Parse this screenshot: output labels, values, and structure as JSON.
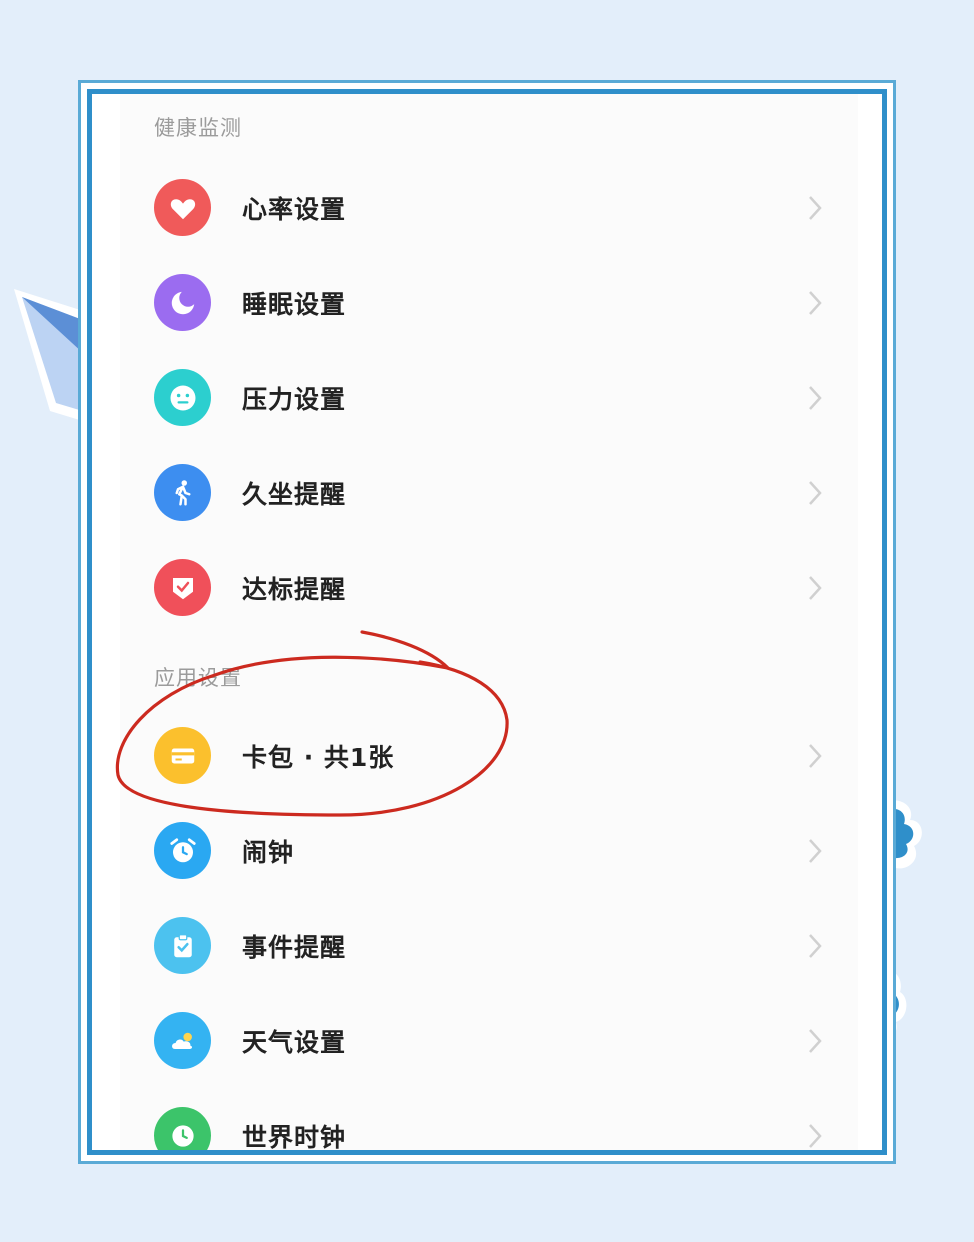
{
  "sections": [
    {
      "title": "健康监测",
      "items": [
        {
          "label": "心率设置",
          "icon": "heart-icon",
          "color": "#f05a5a"
        },
        {
          "label": "睡眠设置",
          "icon": "moon-icon",
          "color": "#9b6cf0"
        },
        {
          "label": "压力设置",
          "icon": "face-icon",
          "color": "#2ccfcf"
        },
        {
          "label": "久坐提醒",
          "icon": "walking-person-icon",
          "color": "#3d8ef0"
        },
        {
          "label": "达标提醒",
          "icon": "badge-check-icon",
          "color": "#f0505a"
        }
      ]
    },
    {
      "title": "应用设置",
      "items": [
        {
          "label": "卡包 · 共1张",
          "icon": "card-icon",
          "color": "#fbc02d"
        },
        {
          "label": "闹钟",
          "icon": "alarm-clock-icon",
          "color": "#2aa8f2"
        },
        {
          "label": "事件提醒",
          "icon": "clipboard-check-icon",
          "color": "#4cc2ef"
        },
        {
          "label": "天气设置",
          "icon": "weather-icon",
          "color": "#34b3f2"
        },
        {
          "label": "世界时钟",
          "icon": "clock-icon",
          "color": "#3cc46a"
        }
      ]
    }
  ],
  "colors": {
    "page_background": "#e3eefa",
    "frame_border": "#2f8fca",
    "annotation_circle": "#cc2a1f"
  }
}
